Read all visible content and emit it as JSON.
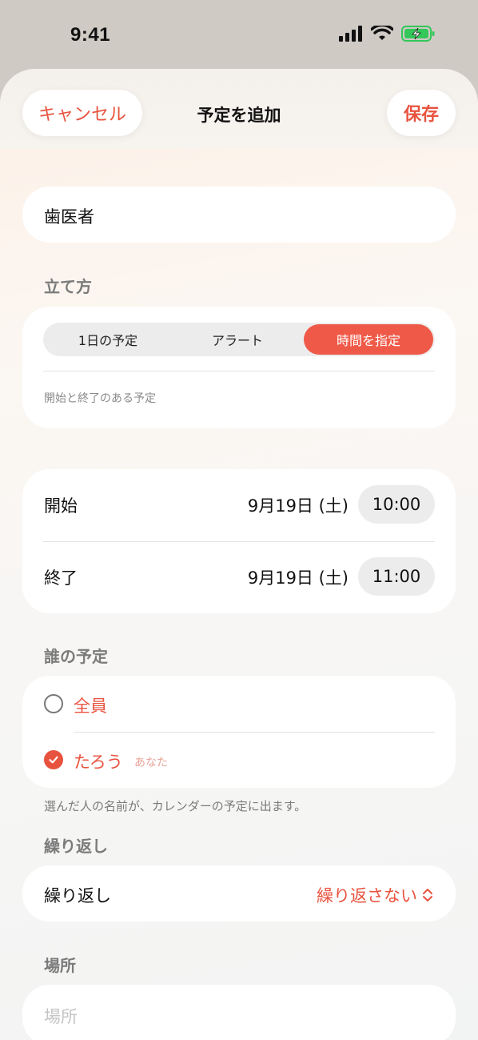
{
  "status_bar": {
    "time": "9:41"
  },
  "nav": {
    "cancel_label": "キャンセル",
    "title": "予定を追加",
    "save_label": "保存"
  },
  "event": {
    "title": "歯医者"
  },
  "method": {
    "section_label": "立て方",
    "options": [
      "1日の予定",
      "アラート",
      "時間を指定"
    ],
    "selected": "時間を指定",
    "description": "開始と終了のある予定"
  },
  "time": {
    "start": {
      "label": "開始",
      "date": "9月19日 (土)",
      "time": "10:00"
    },
    "end": {
      "label": "終了",
      "date": "9月19日 (土)",
      "time": "11:00"
    }
  },
  "who": {
    "section_label": "誰の予定",
    "options": [
      {
        "name": "全員",
        "checked": false,
        "sub": ""
      },
      {
        "name": "たろう",
        "checked": true,
        "sub": "あなた"
      }
    ],
    "note": "選んだ人の名前が、カレンダーの予定に出ます。"
  },
  "repeat": {
    "section_label": "繰り返し",
    "label": "繰り返し",
    "value": "繰り返さない"
  },
  "place": {
    "section_label": "場所",
    "placeholder": "場所"
  },
  "colors": {
    "accent": "#e8533f",
    "segment_active": "#ef5a48"
  },
  "icons": [
    "signal-icon",
    "wifi-icon",
    "battery-charging-icon",
    "radio-unchecked-icon",
    "checkmark-icon",
    "chevron-updown-icon"
  ]
}
